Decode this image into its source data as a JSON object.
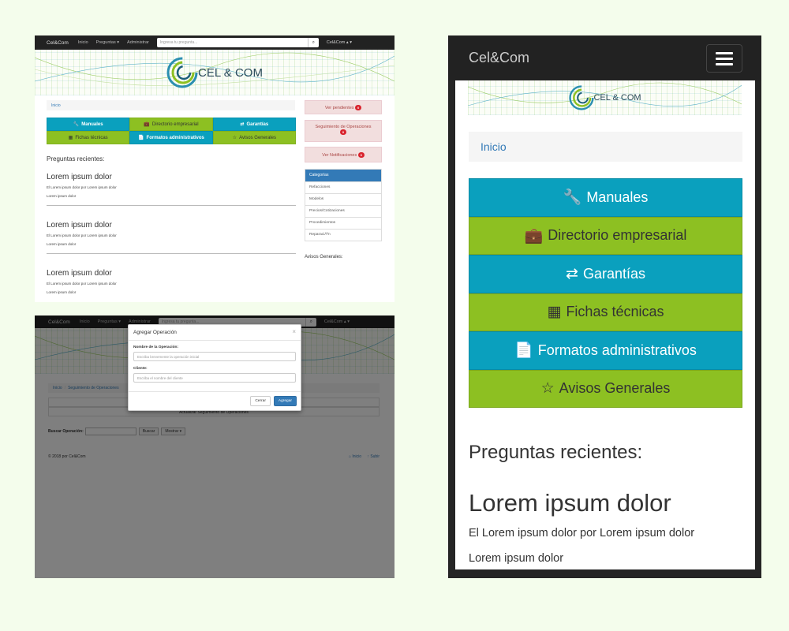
{
  "app": {
    "brand": "Cel&Com",
    "logo_text": "CEL & COM"
  },
  "colors": {
    "nav_bg": "#222222",
    "tile_blue": "#0aa0be",
    "tile_green": "#8dc022",
    "primary": "#337ab7",
    "danger": "#d9232d",
    "page_bg": "#f4fdec"
  },
  "nav": {
    "items": [
      "Inicio",
      "Preguntas ▾",
      "Administrar"
    ],
    "search_placeholder": "Ingresa tu pregunta...",
    "search_icon": "search-icon",
    "user": "Cel&Com ▴ ▾"
  },
  "breadcrumb": {
    "home": "Inicio",
    "current": "Seguimiento de Operaciones"
  },
  "tiles": [
    {
      "label": "Manuales",
      "icon": "wrench-icon",
      "glyph": "🔧",
      "color": "blue"
    },
    {
      "label": "Directorio empresarial",
      "icon": "briefcase-icon",
      "glyph": "💼",
      "color": "green"
    },
    {
      "label": "Garantías",
      "icon": "retweet-icon",
      "glyph": "⇄",
      "color": "blue"
    },
    {
      "label": "Fichas técnicas",
      "icon": "th-large-icon",
      "glyph": "▦",
      "color": "green"
    },
    {
      "label": "Formatos administrativos",
      "icon": "file-icon",
      "glyph": "📄",
      "color": "blue"
    },
    {
      "label": "Avisos Generales",
      "icon": "star-empty-icon",
      "glyph": "☆",
      "color": "green"
    }
  ],
  "recent": {
    "title": "Preguntas recientes:",
    "posts": [
      {
        "title": "Lorem ipsum dolor",
        "by": "El Lorem ipsum dolor por Lorem ipsum dolor",
        "line": "Lorem ipsum dolor"
      },
      {
        "title": "Lorem ipsum dolor",
        "by": "El Lorem ipsum dolor por Lorem ipsum dolor",
        "line": "Lorem ipsum dolor"
      },
      {
        "title": "Lorem ipsum dolor",
        "by": "El Lorem ipsum dolor por Lorem ipsum dolor",
        "line": "Lorem ipsum dolor"
      }
    ]
  },
  "sidebar": {
    "pending": {
      "label": "Ver pendientes",
      "count": "0"
    },
    "tracking": {
      "label": "Seguimiento de Operaciones",
      "count": "0"
    },
    "notifications": {
      "label": "Ver Notificaciones",
      "count": "0"
    },
    "categories_title": "Categorías",
    "categories": [
      "Refacciones",
      "Modelos",
      "Precios/Cotizaciones",
      "Procedimientos",
      "ReparaciÃ³n"
    ],
    "avisos": "Avisos Generales:"
  },
  "operations": {
    "box_text": "Actualizar Seguimiento de Operaciones",
    "search_label": "Buscar Operación:",
    "search_button": "Buscar",
    "show_select": "Mostrar",
    "footer_copy": "© 2018 por Cel&Com",
    "footer_home": "Inicio",
    "footer_up": "Subir"
  },
  "modal": {
    "title": "Agregar Operación",
    "close": "×",
    "field1_label": "Nombre de la Operación:",
    "field1_placeholder": "Escriba brevemente la operación inicial",
    "field2_label": "Cliente:",
    "field2_placeholder": "Escriba el nombre del cliente",
    "cancel": "Cerrar",
    "submit": "Agregar"
  }
}
